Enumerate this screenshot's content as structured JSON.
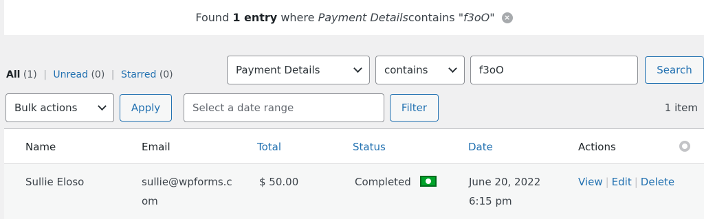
{
  "notice": {
    "prefix": "Found ",
    "count": "1 entry",
    "middle": " where ",
    "field": "Payment Details",
    "op": " contains \"",
    "term": "f3oO",
    "suffix": "\""
  },
  "views": {
    "all": "All",
    "all_count": "(1)",
    "unread": "Unread",
    "unread_count": "(0)",
    "starred": "Starred",
    "starred_count": "(0)",
    "separator": "|"
  },
  "search": {
    "field_select": "Payment Details",
    "operator_select": "contains",
    "term_value": "f3oO",
    "button": "Search"
  },
  "bulk": {
    "select": "Bulk actions",
    "apply": "Apply"
  },
  "date": {
    "placeholder": "Select a date range",
    "filter": "Filter"
  },
  "item_count": "1 item",
  "table": {
    "headers": [
      "Name",
      "Email",
      "Total",
      "Status",
      "Date",
      "Actions"
    ],
    "row": {
      "name": "Sullie Eloso",
      "email_1": "sullie@wpforms.c",
      "email_2": "om",
      "total": "$ 50.00",
      "status": "Completed",
      "date_1": "June 20, 2022",
      "date_2": "6:15 pm",
      "view": "View",
      "edit": "Edit",
      "delete": "Delete",
      "sep": "|"
    }
  },
  "colors": {
    "link": "#2271b1",
    "background": "#f0f0f1",
    "payment_icon": "#00a32a"
  }
}
